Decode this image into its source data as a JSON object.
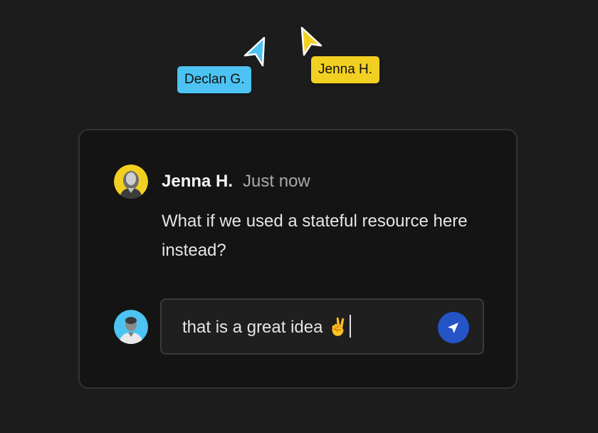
{
  "cursors": [
    {
      "label": "Declan G.",
      "color": "#4cc3f2"
    },
    {
      "label": "Jenna H.",
      "color": "#f2d022"
    }
  ],
  "comment": {
    "author": "Jenna H.",
    "time": "Just now",
    "body": "What if we used a stateful resource here instead?",
    "avatar_bg": "#f2d022"
  },
  "reply": {
    "value": "that is a great idea ✌️",
    "avatar_bg": "#4cc3f2",
    "send_icon": "send-arrow-icon",
    "send_color": "#2454c6"
  }
}
